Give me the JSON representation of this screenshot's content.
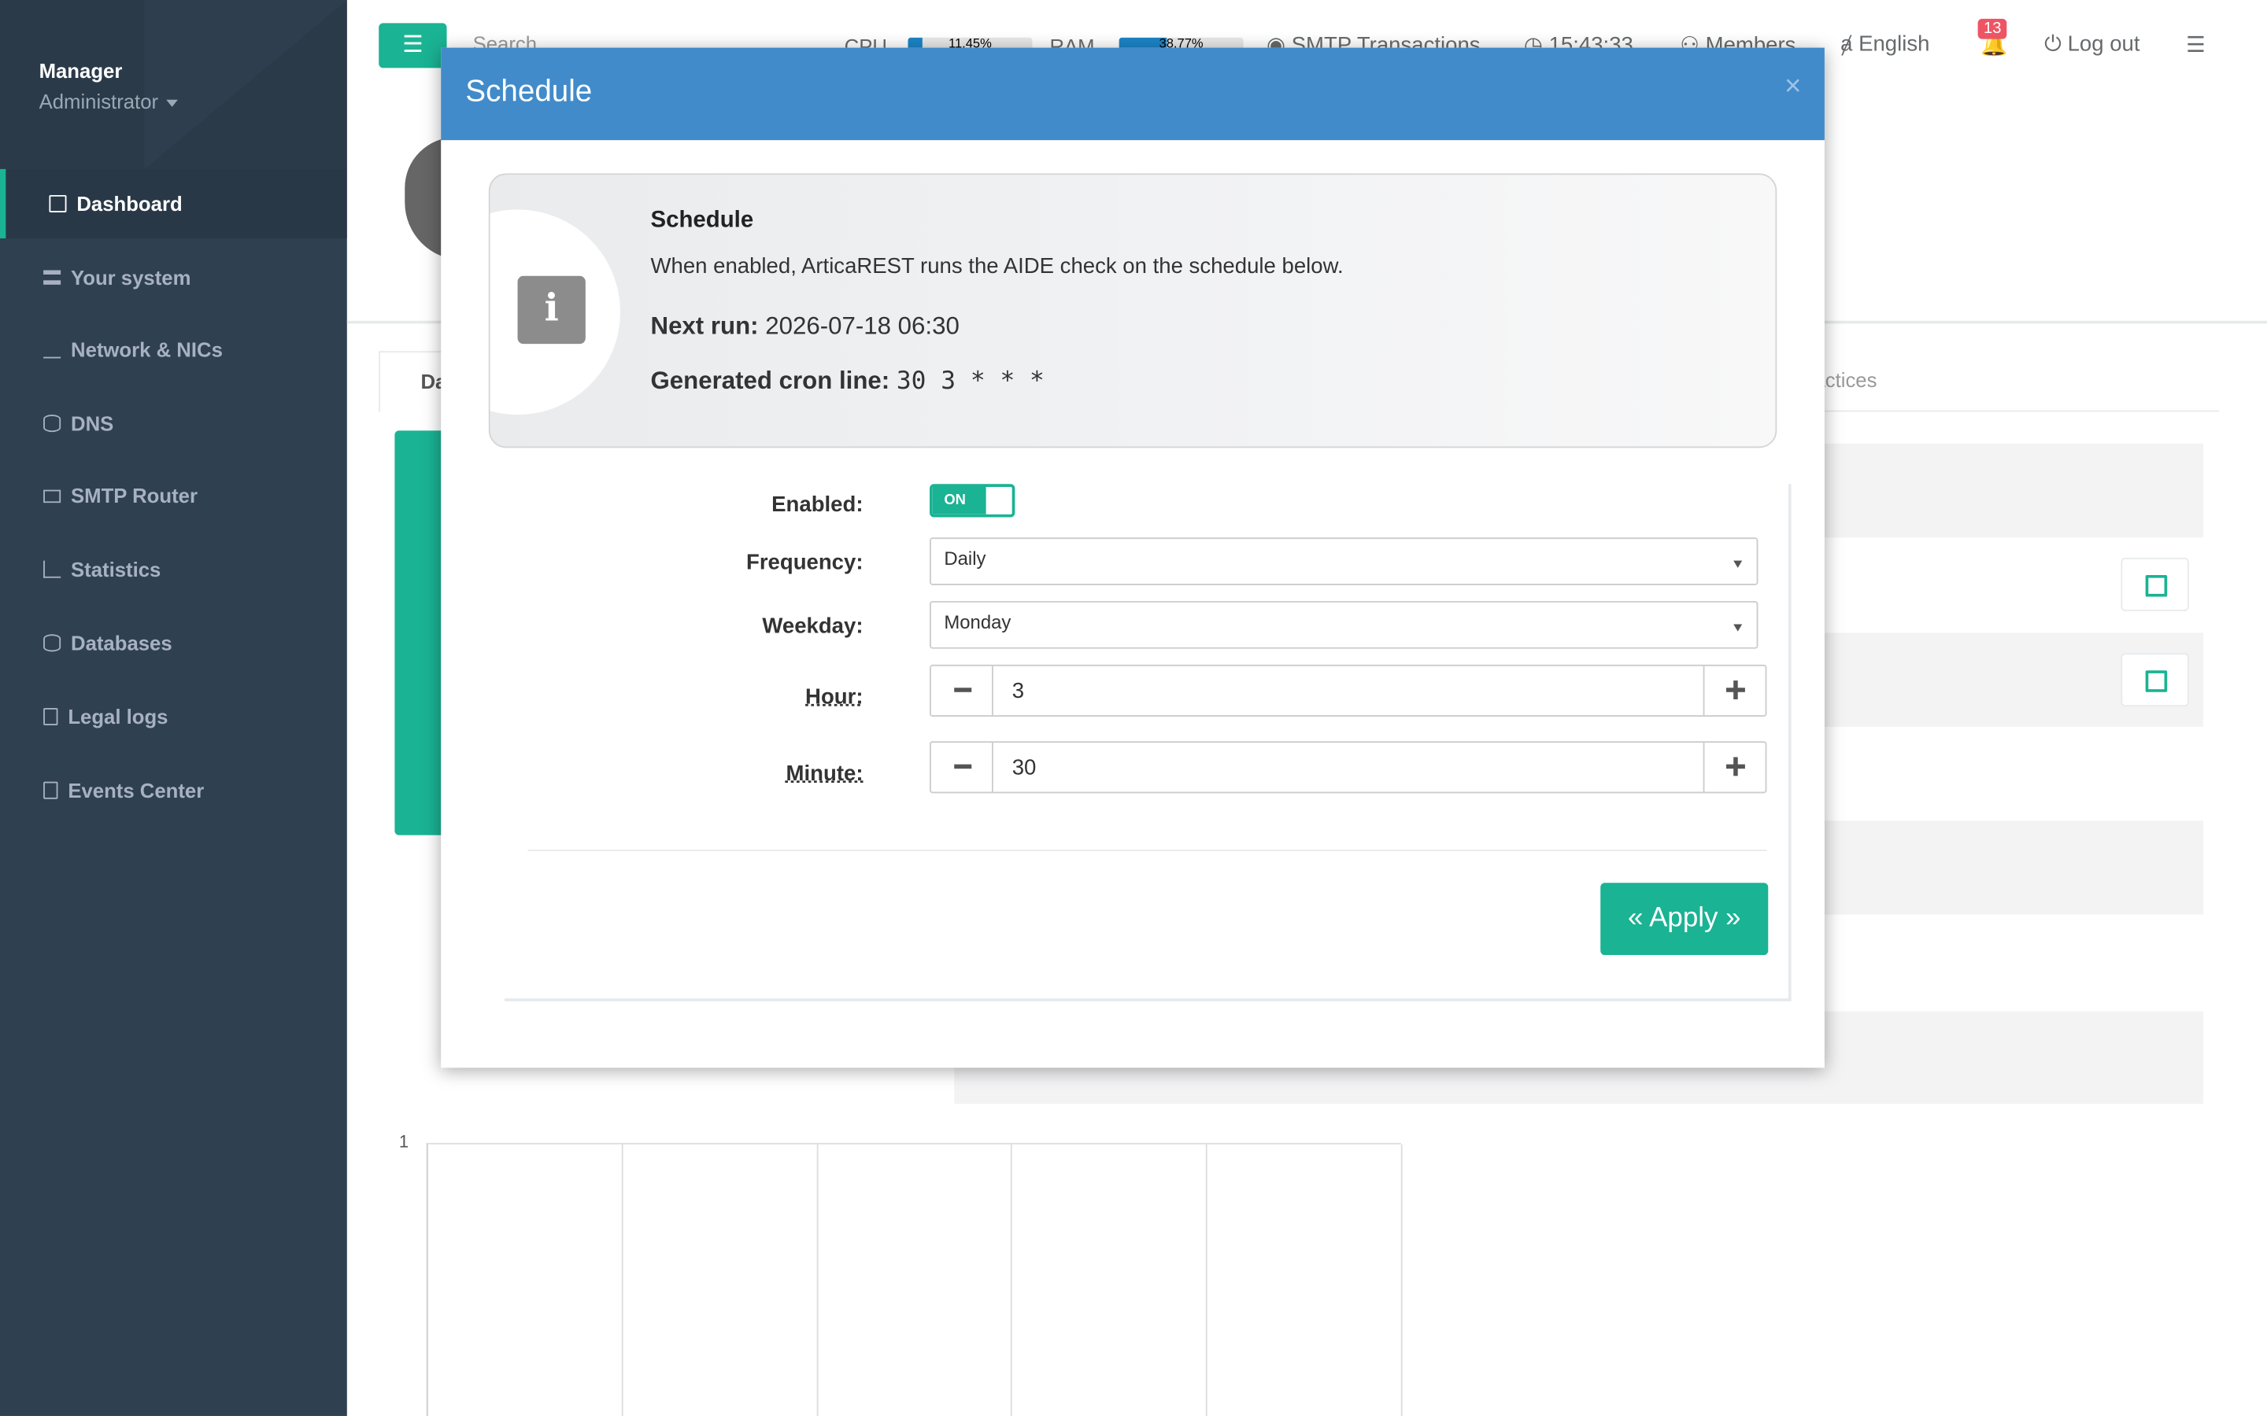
{
  "sidebar": {
    "profile_name": "Manager",
    "profile_role": "Administrator",
    "items": [
      {
        "label": "Dashboard"
      },
      {
        "label": "Your system"
      },
      {
        "label": "Network & NICs"
      },
      {
        "label": "DNS"
      },
      {
        "label": "SMTP Router"
      },
      {
        "label": "Statistics"
      },
      {
        "label": "Databases"
      },
      {
        "label": "Legal logs"
      },
      {
        "label": "Events Center"
      }
    ]
  },
  "topbar": {
    "search_placeholder": "Search",
    "cpu_label": "CPU",
    "cpu_value": "11.45%",
    "cpu_fraction": 0.1145,
    "ram_label": "RAM",
    "ram_value": "38.77%",
    "ram_fraction": 0.3877,
    "smtp_label": "SMTP Transactions",
    "time": "15:43:33",
    "members_label": "Members",
    "language": "English",
    "notifications_count": "13",
    "logout_label": "Log out"
  },
  "page": {
    "tab_partial": "Da",
    "tab_partial_right": "ractices",
    "chart_tick": "1"
  },
  "modal": {
    "title": "Schedule",
    "close_symbol": "×",
    "info": {
      "title": "Schedule",
      "description": "When enabled, ArticaREST runs the AIDE check on the schedule below.",
      "next_run_label": "Next run:",
      "next_run_value": "2026-07-18 06:30",
      "cron_label": "Generated cron line:",
      "cron_value": "30 3 * * *"
    },
    "form": {
      "enabled_label": "Enabled:",
      "enabled_toggle": "ON",
      "frequency_label": "Frequency:",
      "frequency_value": "Daily",
      "weekday_label": "Weekday:",
      "weekday_value": "Monday",
      "hour_label": "Hour:",
      "hour_value": "3",
      "minute_label": "Minute:",
      "minute_value": "30",
      "apply_label": "« Apply »"
    }
  },
  "colors": {
    "sidebar_bg": "#2f4050",
    "accent": "#1ab394",
    "modal_header": "#428bca",
    "badge": "#ed5565"
  }
}
